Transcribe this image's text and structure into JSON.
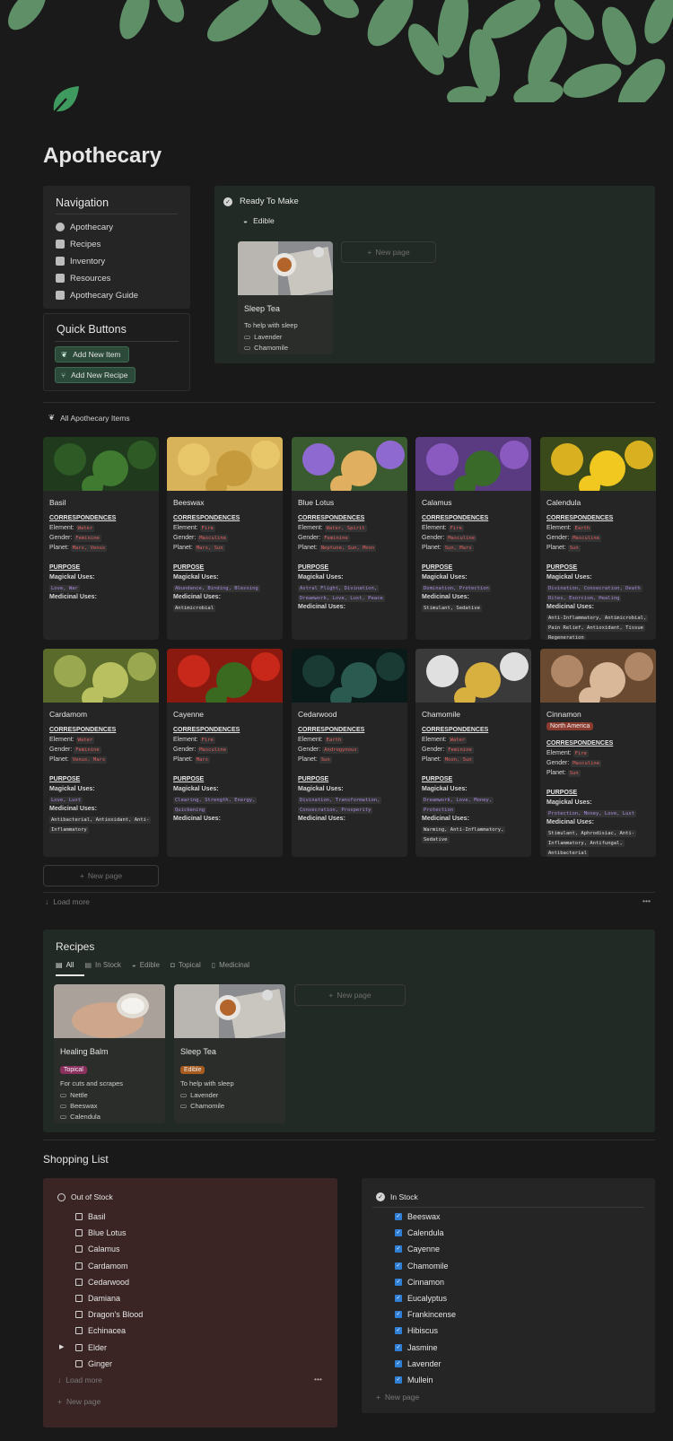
{
  "page": {
    "title": "Apothecary"
  },
  "navigation": {
    "title": "Navigation",
    "items": [
      "Apothecary",
      "Recipes",
      "Inventory",
      "Resources",
      "Apothecary Guide"
    ]
  },
  "quick_buttons": {
    "title": "Quick Buttons",
    "items": [
      "Add New Item",
      "Add New Recipe"
    ]
  },
  "ready_to_make": {
    "title": "Ready To Make",
    "group": "Edible",
    "card": {
      "title": "Sleep Tea",
      "desc": "To help with sleep",
      "ingredients": [
        "Lavender",
        "Chamomile"
      ]
    },
    "new_page": "New page"
  },
  "items_section": {
    "title": "All Apothecary Items",
    "labels": {
      "corr": "CORRESPONDENCES",
      "element": "Element:",
      "gender": "Gender:",
      "planet": "Planet:",
      "purpose": "PURPOSE",
      "magickal": "Magickal Uses:",
      "medicinal": "Medicinal Uses:"
    },
    "items": [
      {
        "name": "Basil",
        "element": "Water",
        "gender": "Feminine",
        "planet": "Mars, Venus",
        "magickal": [
          "Love, War"
        ],
        "medicinal": []
      },
      {
        "name": "Beeswax",
        "element": "Fire",
        "gender": "Masculine",
        "planet": "Mars, Sun",
        "magickal": [
          "Abundance, Binding, Blessing"
        ],
        "medicinal": [
          "Antimicrobial"
        ]
      },
      {
        "name": "Blue Lotus",
        "element": "Water, Spirit",
        "gender": "Feminine",
        "planet": "Neptune, Sun, Moon",
        "magickal": [
          "Astral Flight, Divination,",
          "Dreamwork, Love, Lust, Peace"
        ],
        "medicinal": []
      },
      {
        "name": "Calamus",
        "element": "Fire",
        "gender": "Masculine",
        "planet": "Sun, Mars",
        "magickal": [
          "Domination, Protection"
        ],
        "medicinal": [
          "Stimulant, Sedative"
        ]
      },
      {
        "name": "Calendula",
        "element": "Earth",
        "gender": "Masculine",
        "planet": "Sun",
        "magickal": [
          "Divination, Consecration, Death",
          "Rites, Exorcism, Healing"
        ],
        "medicinal": [
          "Anti-Inflammatory, Antimicrobial,",
          "Pain Relief, Antioxidant, Tissue",
          "Regeneration"
        ]
      },
      {
        "name": "Cardamom",
        "element": "Water",
        "gender": "Feminine",
        "planet": "Venus, Mars",
        "magickal": [
          "Love, Lust"
        ],
        "medicinal": [
          "Antibacterial, Antioxidant, Anti-",
          "Inflammatory"
        ]
      },
      {
        "name": "Cayenne",
        "element": "Fire",
        "gender": "Masculine",
        "planet": "Mars",
        "magickal": [
          "Clearing, Strength, Energy,",
          "Quickening"
        ],
        "medicinal": []
      },
      {
        "name": "Cedarwood",
        "element": "Earth",
        "gender": "Androgynous",
        "planet": "Sun",
        "magickal": [
          "Divination, Transformation,",
          "Consecration, Prosperity"
        ],
        "medicinal": []
      },
      {
        "name": "Chamomile",
        "element": "Water",
        "gender": "Feminine",
        "planet": "Moon, Sun",
        "magickal": [
          "Dreamwork, Love, Money,",
          "Protection"
        ],
        "medicinal": [
          "Warming, Anti-Inflammatory,",
          "Sedative"
        ]
      },
      {
        "name": "Cinnamon",
        "region": "North America",
        "element": "Fire",
        "gender": "Masculine",
        "planet": "Sun",
        "magickal": [
          "Protection, Money, Love, Lust"
        ],
        "medicinal": [
          "Stimulant, Aphrodisiac, Anti-",
          "Inflammatory, Antifungal,",
          "Antibacterial"
        ]
      }
    ],
    "new_page": "New page",
    "load_more": "Load more"
  },
  "recipes": {
    "title": "Recipes",
    "tabs": [
      "All",
      "In Stock",
      "Edible",
      "Topical",
      "Medicinal"
    ],
    "cards": [
      {
        "title": "Healing Balm",
        "tag": "Topical",
        "desc": "For cuts and scrapes",
        "ingredients": [
          "Nettle",
          "Beeswax",
          "Calendula"
        ]
      },
      {
        "title": "Sleep Tea",
        "tag": "Edible",
        "desc": "To help with sleep",
        "ingredients": [
          "Lavender",
          "Chamomile"
        ]
      }
    ],
    "new_page": "New page"
  },
  "shopping": {
    "title": "Shopping List",
    "out_title": "Out of Stock",
    "out_items": [
      "Basil",
      "Blue Lotus",
      "Calamus",
      "Cardamom",
      "Cedarwood",
      "Damiana",
      "Dragon's Blood",
      "Echinacea",
      "Elder",
      "Ginger"
    ],
    "in_title": "In Stock",
    "in_items": [
      "Beeswax",
      "Calendula",
      "Cayenne",
      "Chamomile",
      "Cinnamon",
      "Eucalyptus",
      "Frankincense",
      "Hibiscus",
      "Jasmine",
      "Lavender",
      "Mullein"
    ],
    "load_more": "Load more",
    "new_page": "New page"
  },
  "colors": {
    "accent_green": "#5a8f6a",
    "tag_red": "#e46060",
    "tag_purple": "#a88be0"
  }
}
